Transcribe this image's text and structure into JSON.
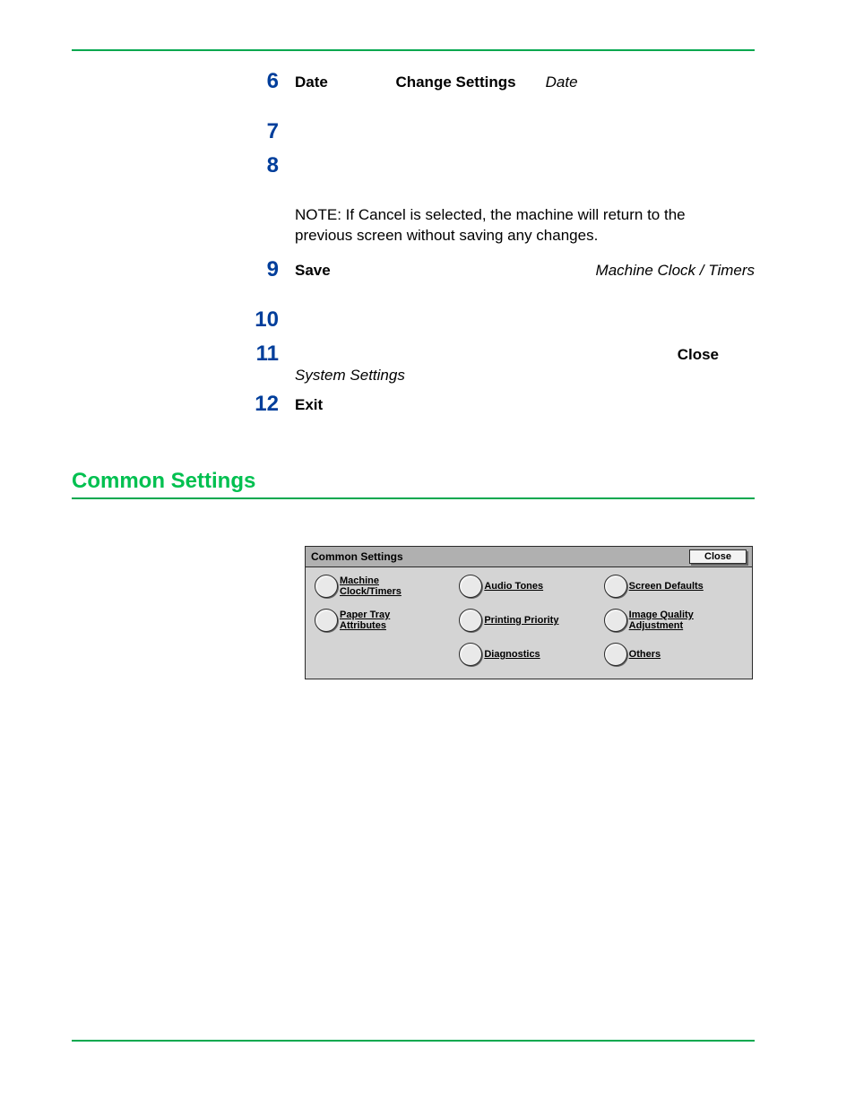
{
  "steps": {
    "s6": {
      "num": "6",
      "t1": "Date",
      "t2": "Change Settings",
      "t3": "Date"
    },
    "s7": {
      "num": "7"
    },
    "s8": {
      "num": "8"
    },
    "note": {
      "lead": "NOTE:",
      "pre": " If ",
      "b": "Cancel",
      "post": " is selected, the machine will return to the previous screen without saving any changes."
    },
    "s9": {
      "num": "9",
      "t1": "Save",
      "t2": "Machine Clock / Timers"
    },
    "s10": {
      "num": "10"
    },
    "s11": {
      "num": "11",
      "t1": "Close",
      "t2": "System Settings"
    },
    "s12": {
      "num": "12",
      "t1": "Exit"
    }
  },
  "section_heading": "Common Settings",
  "panel": {
    "title": "Common Settings",
    "close": "Close",
    "options": {
      "o1": "Machine Clock/Timers",
      "o2": "Audio Tones",
      "o3": "Screen Defaults",
      "o4": "Paper Tray Attributes",
      "o5": "Printing Priority",
      "o6": "Image Quality Adjustment",
      "o7": "Diagnostics",
      "o8": "Others"
    }
  }
}
